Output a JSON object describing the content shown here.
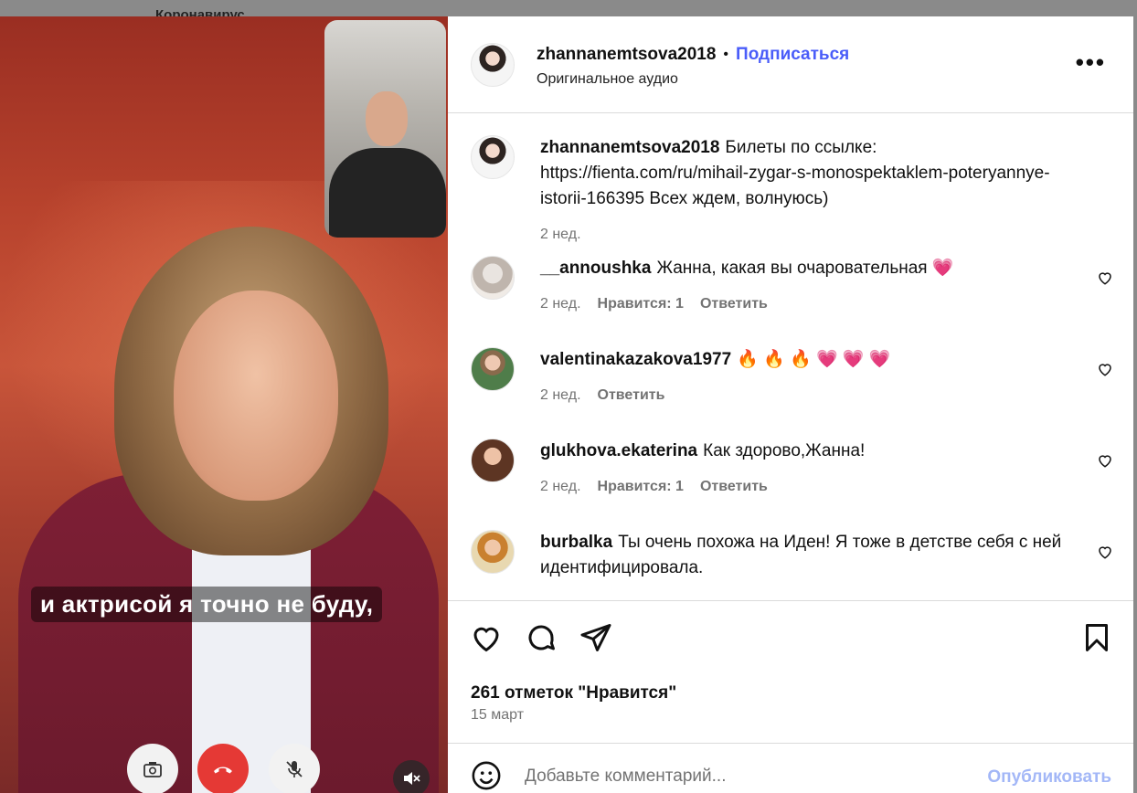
{
  "backdrop": {
    "label": "Коронавирус"
  },
  "video": {
    "subtitle": "и актрисой я точно не буду,"
  },
  "header": {
    "username": "zhannanemtsova2018",
    "separator": "•",
    "follow_label": "Подписаться",
    "audio_label": "Оригинальное аудио",
    "more_label": "•••"
  },
  "caption": {
    "username": "zhannanemtsova2018",
    "text": "Билеты по ссылке: https://fienta.com/ru/mihail-zygar-s-monospektaklem-poteryannye-istorii-166395 Всех ждем, волнуюсь)",
    "time": "2 нед."
  },
  "comments": [
    {
      "username": "__annoushka",
      "text": "Жанна, какая вы очаровательная",
      "emoji": "💗",
      "time": "2 нед.",
      "likes": "Нравится: 1",
      "reply": "Ответить"
    },
    {
      "username": "valentinakazakova1977",
      "text": "",
      "emoji": "🔥 🔥 🔥 💗 💗 💗",
      "time": "2 нед.",
      "likes": "",
      "reply": "Ответить"
    },
    {
      "username": "glukhova.ekaterina",
      "text": "Как здорово,Жанна!",
      "emoji": "",
      "time": "2 нед.",
      "likes": "Нравится: 1",
      "reply": "Ответить"
    },
    {
      "username": "burbalka",
      "text": "Ты очень похожа на Иден! Я тоже в детстве себя с ней идентифицировала.",
      "emoji": "",
      "time": "",
      "likes": "",
      "reply": ""
    }
  ],
  "stats": {
    "likes": "261 отметок \"Нравится\"",
    "date": "15 март"
  },
  "composer": {
    "placeholder": "Добавьте комментарий...",
    "publish_label": "Опубликовать"
  },
  "colors": {
    "accent": "#4a5df9",
    "publish_disabled": "#a3b7f7",
    "hangup": "#e53935"
  }
}
